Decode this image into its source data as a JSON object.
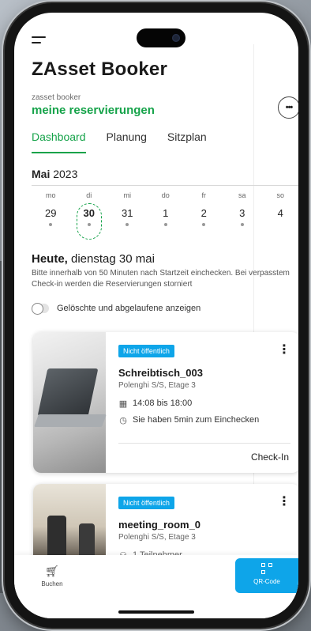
{
  "app": {
    "title": "ZAsset Booker",
    "subtitle_small": "zasset booker",
    "subtitle": "meine reservierungen",
    "more_label": "•••"
  },
  "tabs": [
    {
      "label": "Dashboard",
      "active": true
    },
    {
      "label": "Planung",
      "active": false
    },
    {
      "label": "Sitzplan",
      "active": false
    }
  ],
  "calendar": {
    "month": "Mai",
    "year": "2023",
    "days": [
      {
        "dow": "mo",
        "num": "29",
        "dot": true
      },
      {
        "dow": "di",
        "num": "30",
        "dot": true,
        "today": true
      },
      {
        "dow": "mi",
        "num": "31",
        "dot": true
      },
      {
        "dow": "do",
        "num": "1",
        "dot": true
      },
      {
        "dow": "fr",
        "num": "2",
        "dot": true
      },
      {
        "dow": "sa",
        "num": "3",
        "dot": true
      },
      {
        "dow": "so",
        "num": "4",
        "dot": false
      }
    ]
  },
  "today": {
    "label": "Heute,",
    "date": " dienstag 30 mai",
    "note": "Bitte innerhalb von 50 Minuten nach Startzeit einchecken. Bei verpasstem Check-in werden die Reservierungen storniert"
  },
  "toggle": {
    "label": "Gelöschte und abgelaufene anzeigen",
    "on": false
  },
  "reservations": [
    {
      "badge": "Nicht öffentlich",
      "title": "Schreibtisch_003",
      "location": "Polenghi S/S, Etage 3",
      "time": "14:08 bis 18:00",
      "checkin_hint": "Sie haben 5min zum Einchecken",
      "action": "Check-In"
    },
    {
      "badge": "Nicht öffentlich",
      "title": "meeting_room_0",
      "location": "Polenghi S/S, Etage 3",
      "participants": "1 Teilnehmer"
    }
  ],
  "bottom_nav": {
    "buchen": "Buchen",
    "qr": "QR-Code"
  },
  "colors": {
    "accent_green": "#16a34a",
    "badge_blue": "#0ea5e9"
  },
  "icons": {
    "menu": "hamburger-icon",
    "more": "more-icon",
    "calendar_time": "calendar-clock-icon",
    "clock": "clock-icon",
    "participants": "people-icon",
    "buchen": "cart-icon",
    "qr": "qr-code-icon"
  }
}
